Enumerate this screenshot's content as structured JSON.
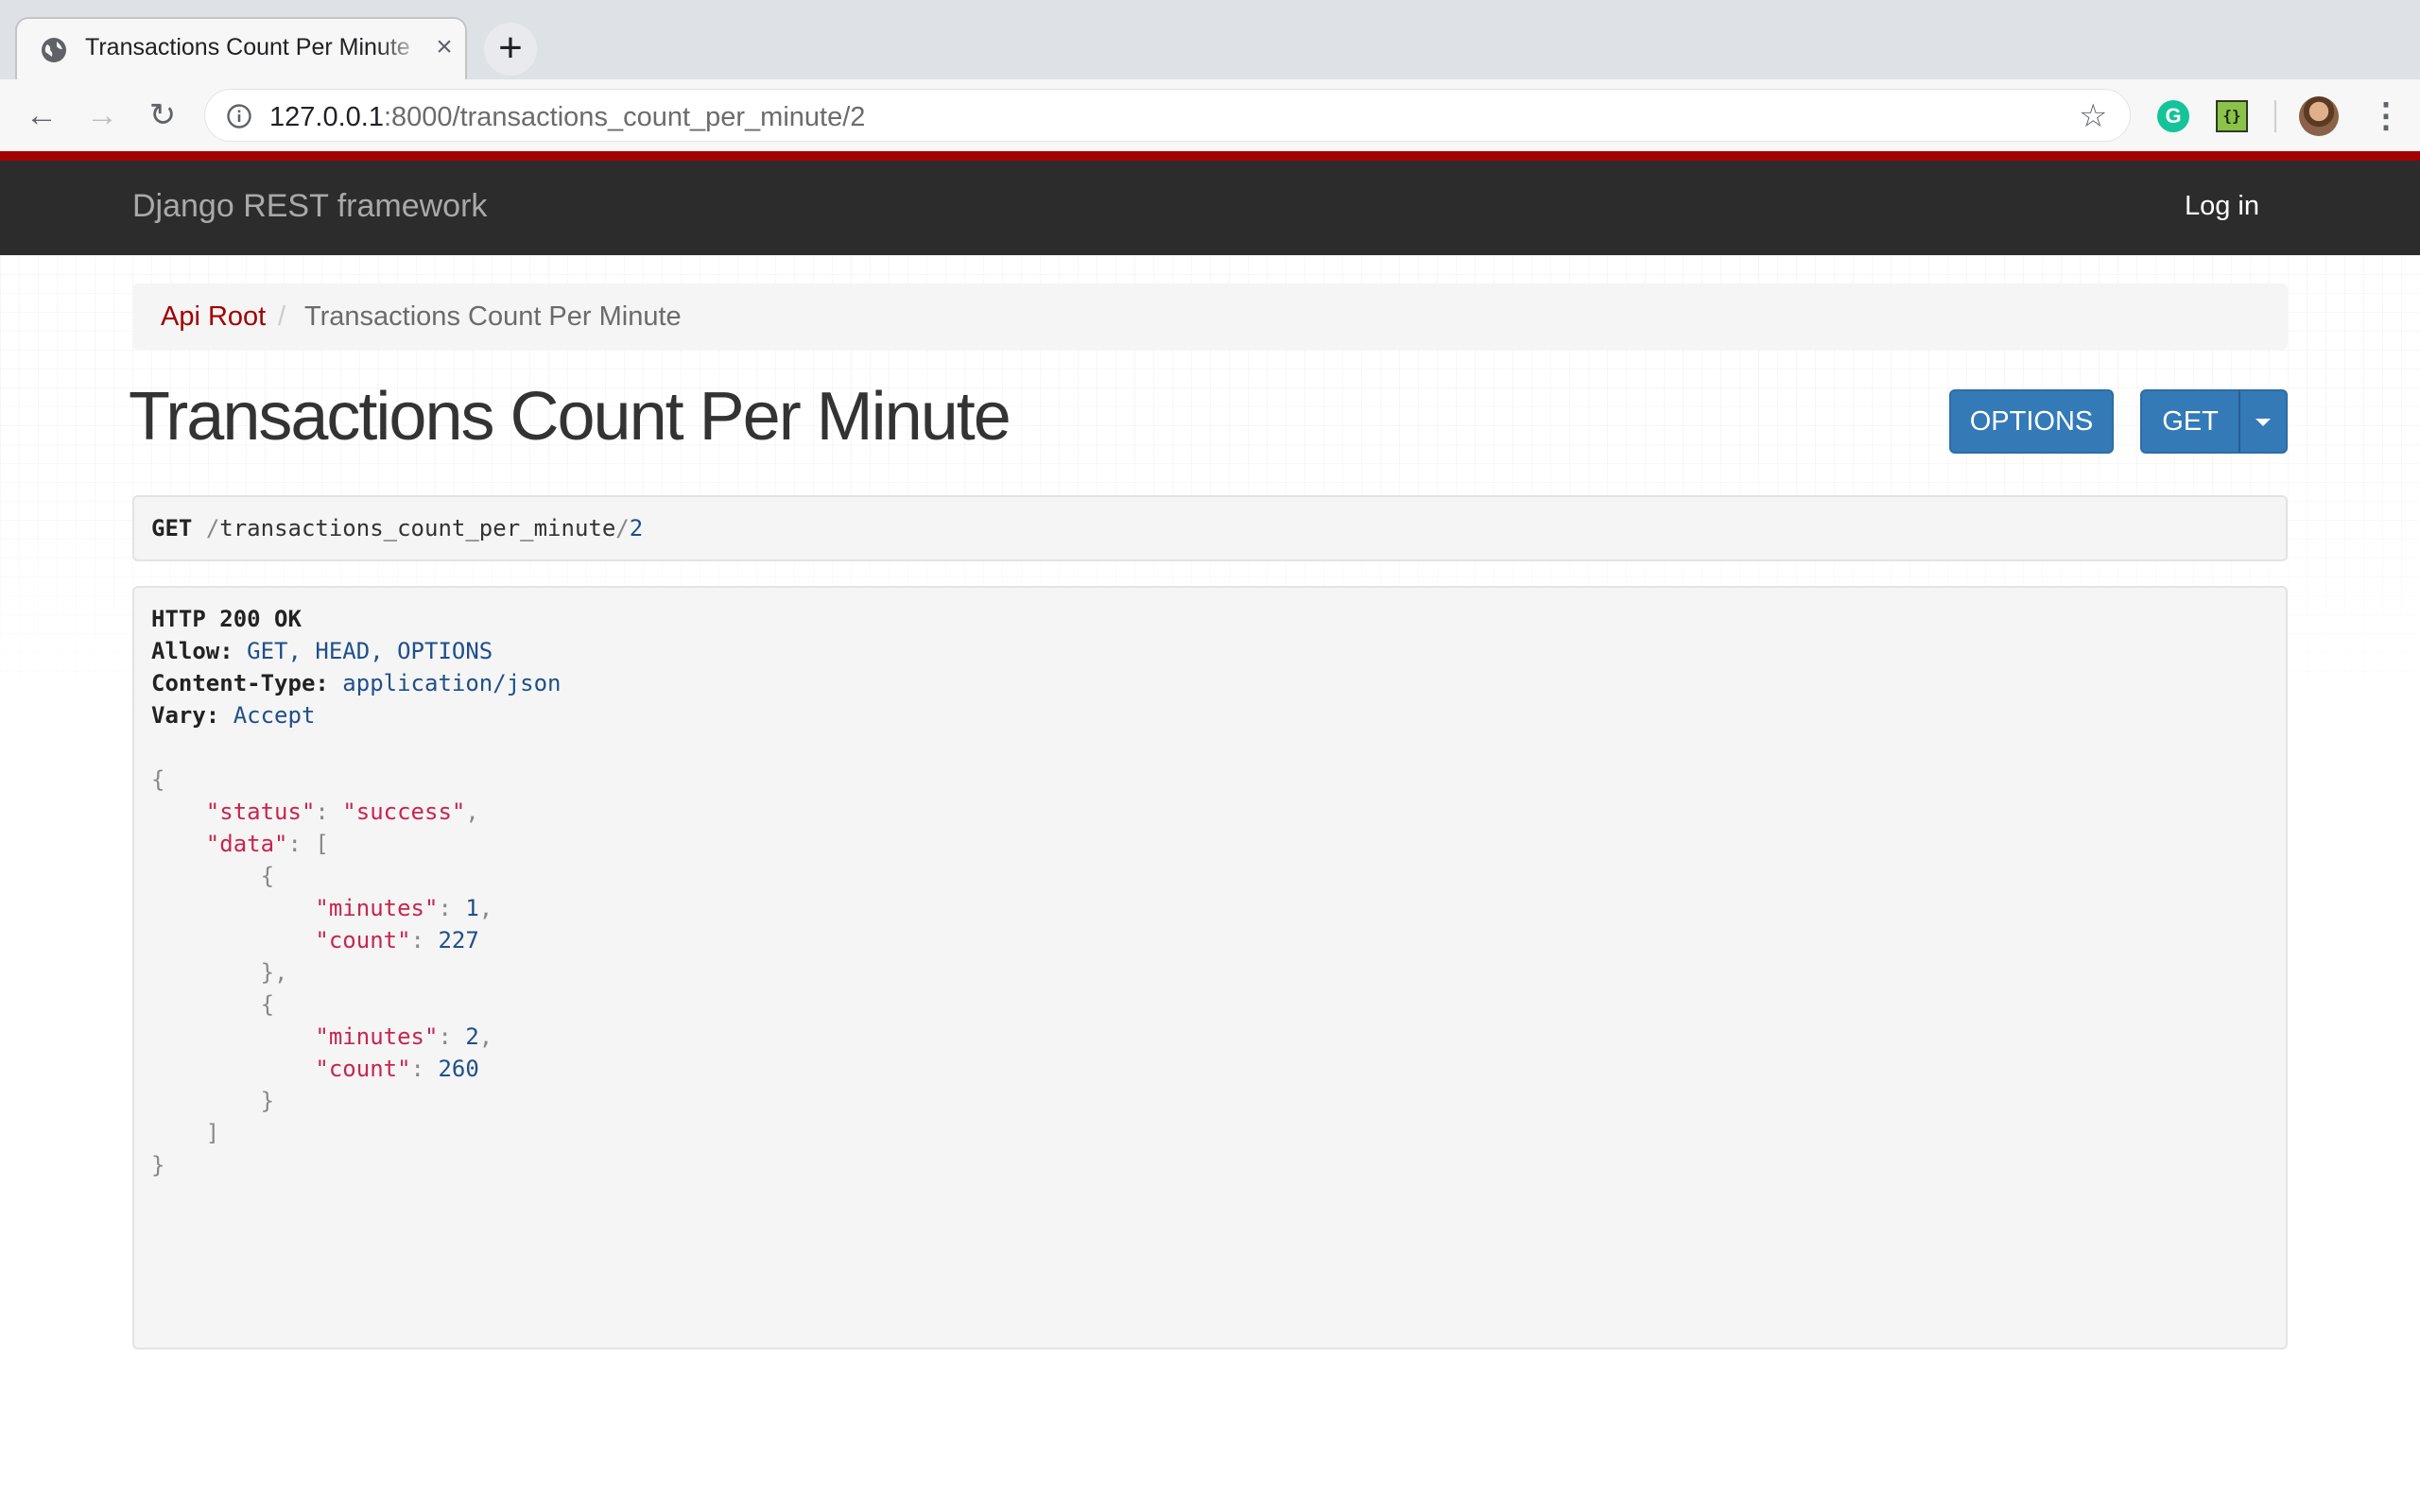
{
  "browser": {
    "tab_title": "Transactions Count Per Minute",
    "url_host": "127.0.0.1",
    "url_rest": ":8000/transactions_count_per_minute/2"
  },
  "navbar": {
    "brand": "Django REST framework",
    "login": "Log in"
  },
  "breadcrumb": {
    "root": "Api Root",
    "separator": "/",
    "current": "Transactions Count Per Minute"
  },
  "page": {
    "title": "Transactions Count Per Minute",
    "options_button": "OPTIONS",
    "get_button": "GET"
  },
  "request": {
    "method": "GET",
    "path_slash1": "/",
    "path_name": "transactions_count_per_minute",
    "path_slash2": "/",
    "path_id": "2"
  },
  "response": {
    "status_line": "HTTP 200 OK",
    "allow_label": "Allow:",
    "allow_value": "GET, HEAD, OPTIONS",
    "content_type_label": "Content-Type:",
    "content_type_value": "application/json",
    "vary_label": "Vary:",
    "vary_value": "Accept",
    "body": {
      "status_key": "\"status\"",
      "status_value": "\"success\"",
      "data_key": "\"data\"",
      "items": [
        {
          "minutes_key": "\"minutes\"",
          "minutes": "1",
          "count_key": "\"count\"",
          "count": "227"
        },
        {
          "minutes_key": "\"minutes\"",
          "minutes": "2",
          "count_key": "\"count\"",
          "count": "260"
        }
      ]
    }
  },
  "colors": {
    "accent": "#a30000",
    "navbar_bg": "#2c2c2c",
    "button_primary": "#337ab7"
  }
}
